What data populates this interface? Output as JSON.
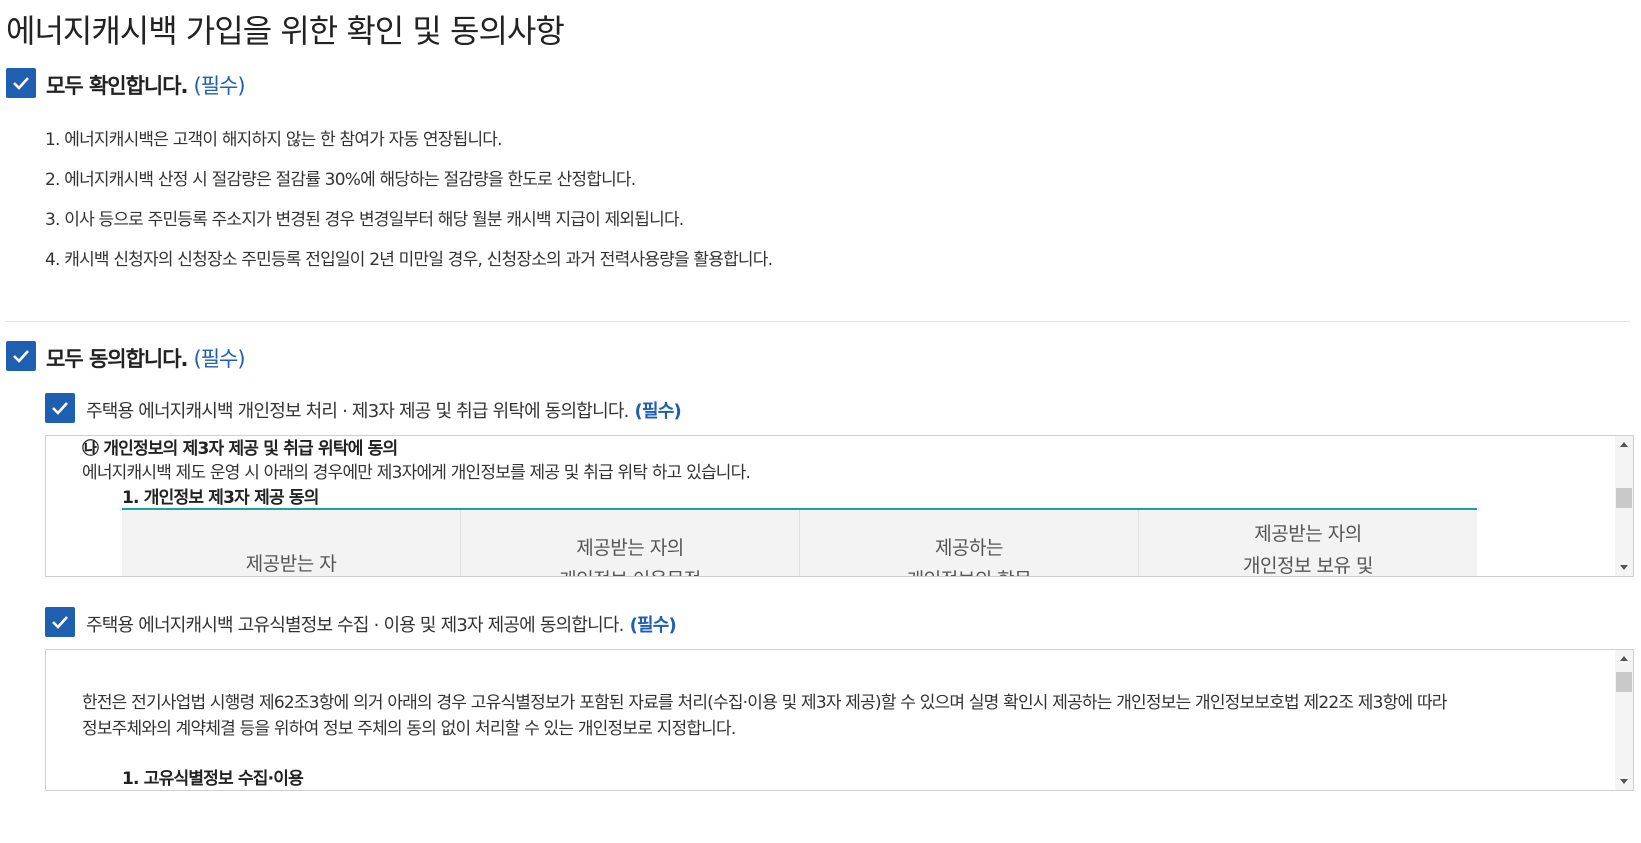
{
  "page": {
    "title": "에너지캐시백 가입을 위한 확인 및 동의사항"
  },
  "confirm": {
    "label": "모두 확인합니다.",
    "required": "(필수)",
    "items": [
      "1. 에너지캐시백은 고객이 해지하지 않는 한 참여가 자동 연장됩니다.",
      "2. 에너지캐시백 산정 시 절감량은 절감률 30%에 해당하는 절감량을 한도로 산정합니다.",
      "3. 이사 등으로 주민등록 주소지가 변경된 경우 변경일부터 해당 월분 캐시백 지급이 제외됩니다.",
      "4. 캐시백 신청자의 신청장소 주민등록 전입일이 2년 미만일 경우, 신청장소의 과거 전력사용량을 활용합니다."
    ]
  },
  "agree": {
    "label": "모두 동의합니다.",
    "required": "(필수)"
  },
  "consent1": {
    "label": "주택용 에너지캐시백 개인정보 처리 · 제3자 제공 및 취급 위탁에 동의합니다.",
    "required": "(필수)",
    "section_title": "㉯ 개인정보의 제3자 제공 및 취급 위탁에 동의",
    "intro": "에너지캐시백 제도 운영 시 아래의 경우에만 제3자에게 개인정보를 제공 및 취급 위탁 하고 있습니다.",
    "subsection": "1. 개인정보 제3자 제공 동의",
    "table_headers": [
      [
        "제공받는 자"
      ],
      [
        "제공받는 자의",
        "개인정보 이용목적"
      ],
      [
        "제공하는",
        "개인정보의 항목"
      ],
      [
        "제공받는 자의",
        "개인정보 보유 및"
      ]
    ]
  },
  "consent2": {
    "label": "주택용 에너지캐시백 고유식별정보 수집 · 이용 및 제3자 제공에 동의합니다.",
    "required": "(필수)",
    "para_line1": "한전은 전기사업법 시행령 제62조3항에 의거 아래의 경우 고유식별정보가 포함된 자료를 처리(수집·이용 및 제3자 제공)할 수 있으며 실명 확인시 제공하는 개인정보는 개인정보보호법 제22조 제3항에 따라",
    "para_line2": "정보주체와의 계약체결 등을 위하여 정보 주체의 동의 없이 처리할 수 있는 개인정보로 지정합니다.",
    "subsection": "1. 고유식별정보 수집·이용"
  },
  "colors": {
    "accent": "#1f5fb0",
    "table_border": "#1aa39a"
  }
}
